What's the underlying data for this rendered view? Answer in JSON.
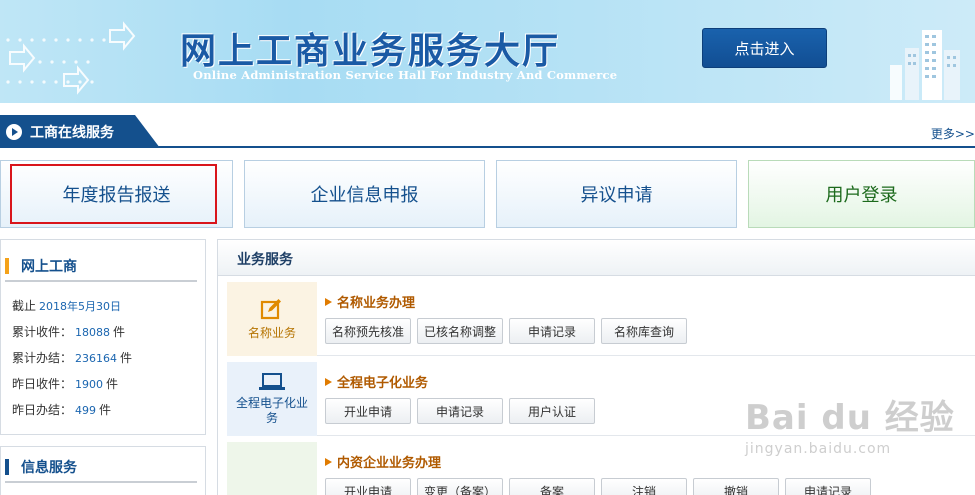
{
  "banner": {
    "title": "网上工商业务服务大厅",
    "subtitle": "Online Administration Service Hall For Industry And Commerce",
    "enter_button": "点击进入"
  },
  "section": {
    "title": "工商在线服务",
    "more": "更多>>"
  },
  "quick_buttons": [
    {
      "label": "年度报告报送",
      "selected": true
    },
    {
      "label": "企业信息申报"
    },
    {
      "label": "异议申请"
    },
    {
      "label": "用户登录"
    }
  ],
  "left_panel": {
    "title": "网上工商",
    "stats": [
      {
        "label": "截止",
        "value": "2018年5月30日",
        "unit": ""
      },
      {
        "label": "累计收件：",
        "value": "18088",
        "unit": "件"
      },
      {
        "label": "累计办结：",
        "value": "236164",
        "unit": "件"
      },
      {
        "label": "昨日收件：",
        "value": "1900",
        "unit": "件"
      },
      {
        "label": "昨日办结：",
        "value": "499",
        "unit": "件"
      }
    ],
    "second_title": "信息服务"
  },
  "main": {
    "title": "业务服务",
    "rows": [
      {
        "icon_label": "名称业务",
        "title": "名称业务办理",
        "buttons": [
          "名称预先核准",
          "已核名称调整",
          "申请记录",
          "名称库查询"
        ]
      },
      {
        "icon_label": "全程电子化业务",
        "title": "全程电子化业务",
        "buttons": [
          "开业申请",
          "申请记录",
          "用户认证"
        ]
      },
      {
        "icon_label": "",
        "title": "内资企业业务办理",
        "buttons": [
          "开业申请",
          "变更（备案）",
          "备案",
          "注销",
          "撤销",
          "申请记录"
        ]
      }
    ]
  },
  "watermark": {
    "main": "Bai du 经验",
    "sub": "jingyan.baidu.com"
  },
  "colors": {
    "brand_blue": "#14508d",
    "highlight_red": "#d9151b",
    "accent_orange": "#f4a21a"
  }
}
